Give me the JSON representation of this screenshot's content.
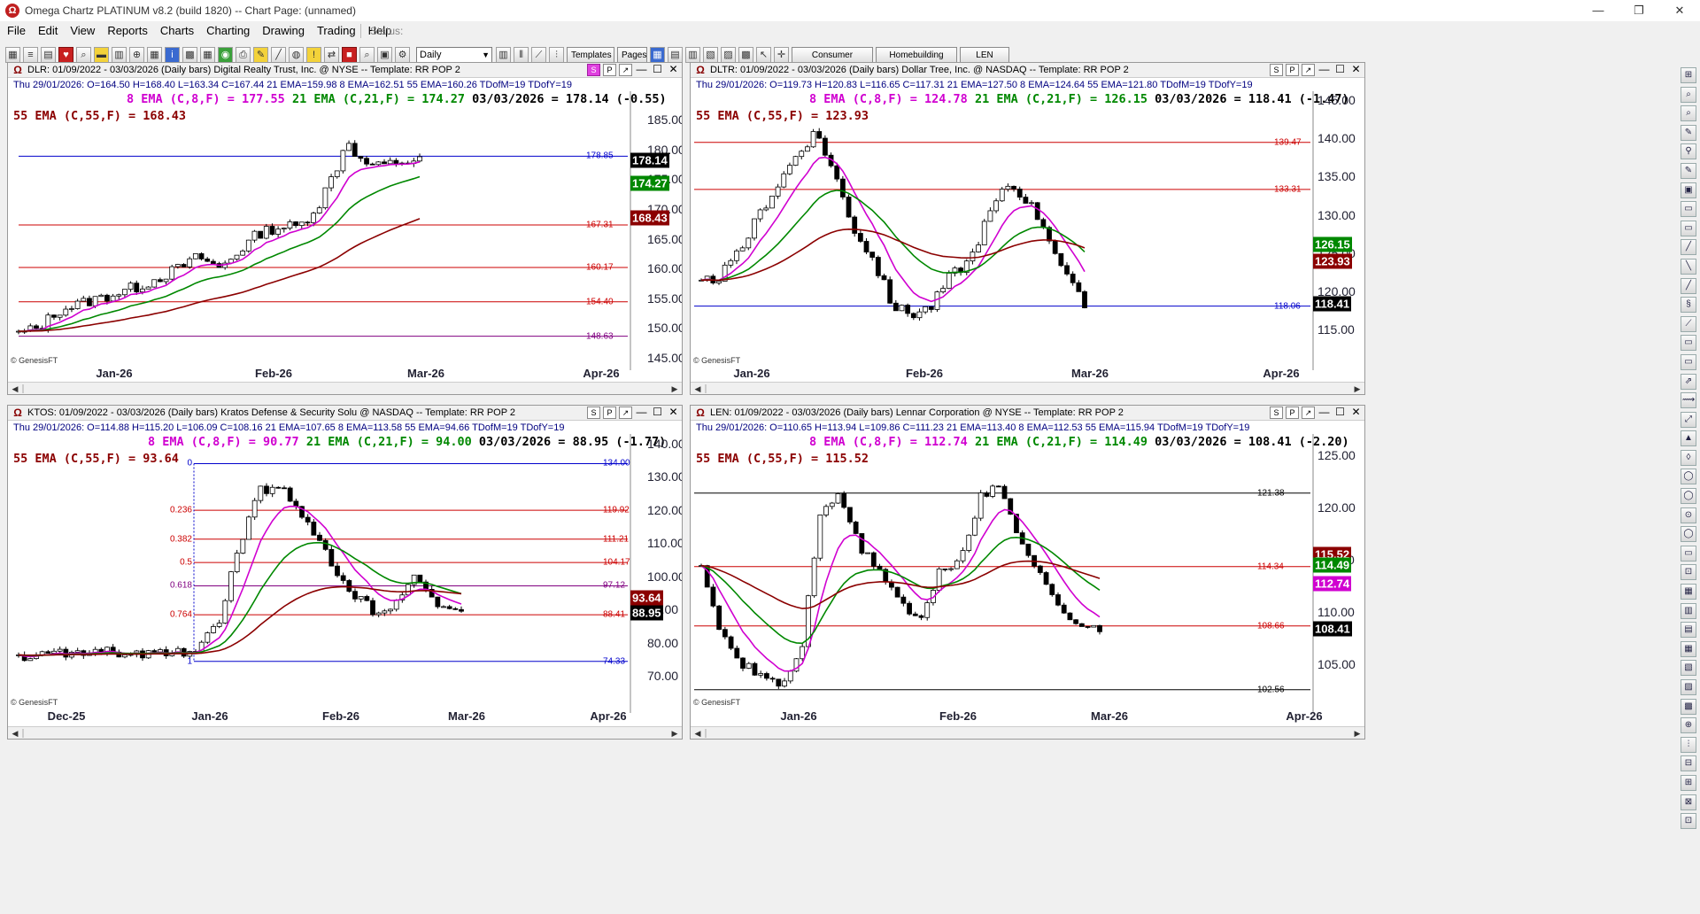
{
  "window": {
    "title": "Omega Chartz PLATINUM v8.2 (build 1820)  --  Chart Page: (unnamed)",
    "icon": "omega-app-icon"
  },
  "menu": {
    "items": [
      "File",
      "Edit",
      "View",
      "Reports",
      "Charts",
      "Charting",
      "Drawing",
      "Trading",
      "Help"
    ],
    "status_label": "Status:"
  },
  "toolbar": {
    "period_select": "Daily",
    "templates_label": "Templates",
    "pages_label": "Pages",
    "tabs": [
      "Consumer Durables & A",
      "Homebuilding",
      "LEN"
    ]
  },
  "charts": [
    {
      "id": "dlr",
      "header": "DLR: 01/09/2022 - 03/03/2026  (Daily bars)   Digital Realty Trust, Inc. @ NYSE  --  Template: RR POP 2",
      "quote": "Thu  29/01/2026:  O=164.50  H=168.40  L=163.34  C=167.44  21 EMA=159.98  8 EMA=162.51  55 EMA=160.26  TDofM=19  TDofY=19",
      "ema8": "8 EMA (C,8,F) = 177.55",
      "ema21": "21 EMA (C,21,F) = 174.27",
      "last": "03/03/2026 = 178.14 (-0.55)",
      "ema55": "55 EMA (C,55,F) = 168.43",
      "yticks": [
        "185.00",
        "180.00",
        "175.00",
        "170.00",
        "165.00",
        "160.00",
        "155.00",
        "150.00",
        "145.00"
      ],
      "levels": [
        "178.85",
        "167.31",
        "160.17",
        "154.40",
        "148.63"
      ],
      "price_boxes": [
        "178.14",
        "174.27",
        "168.43"
      ],
      "xlabels": [
        "Jan-26",
        "Feb-26",
        "Mar-26",
        "Apr-26"
      ],
      "credit": "© GenesisFT"
    },
    {
      "id": "dltr",
      "header": "DLTR: 01/09/2022 - 03/03/2026  (Daily bars)   Dollar Tree, Inc. @ NASDAQ  --  Template: RR POP 2",
      "quote": "Thu  29/01/2026:  O=119.73  H=120.83  L=116.65  C=117.31  21 EMA=127.50  8 EMA=124.64  55 EMA=121.80  TDofM=19  TDofY=19",
      "ema8": "8 EMA (C,8,F) = 124.78",
      "ema21": "21 EMA (C,21,F) = 126.15",
      "last": "03/03/2026 = 118.41 (-1.47)",
      "ema55": "55 EMA (C,55,F) = 123.93",
      "yticks": [
        "145.00",
        "140.00",
        "135.00",
        "130.00",
        "125.00",
        "120.00",
        "115.00"
      ],
      "levels": [
        "139.47",
        "133.31",
        "118.06"
      ],
      "price_boxes": [
        "126.15",
        "123.93",
        "118.41"
      ],
      "xlabels": [
        "Jan-26",
        "Feb-26",
        "Mar-26",
        "Apr-26"
      ],
      "credit": "© GenesisFT"
    },
    {
      "id": "ktos",
      "header": "KTOS: 01/09/2022 - 03/03/2026  (Daily bars)   Kratos Defense & Security Solu @ NASDAQ  --  Template: RR POP 2",
      "quote": "Thu  29/01/2026:  O=114.88  H=115.20  L=106.09  C=108.16  21 EMA=107.65  8 EMA=113.58  55 EMA=94.66  TDofM=19  TDofY=19",
      "ema8": "8 EMA (C,8,F) = 90.77",
      "ema21": "21 EMA (C,21,F) = 94.00",
      "last": "03/03/2026 = 88.95 (-1.77)",
      "ema55": "55 EMA (C,55,F) = 93.64",
      "yticks": [
        "140.00",
        "130.00",
        "120.00",
        "110.00",
        "100.00",
        "90.00",
        "80.00",
        "70.00"
      ],
      "levels": [
        "134.00",
        "119.92",
        "111.21",
        "104.17",
        "97.12",
        "88.41",
        "74.33"
      ],
      "fib_labels": [
        "0",
        "0.236",
        "0.382",
        "0.5",
        "0.618",
        "0.764",
        "1"
      ],
      "price_boxes": [
        "93.64",
        "88.95"
      ],
      "xlabels": [
        "Dec-25",
        "Jan-26",
        "Feb-26",
        "Mar-26",
        "Apr-26"
      ],
      "credit": "© GenesisFT"
    },
    {
      "id": "len",
      "header": "LEN: 01/09/2022 - 03/03/2026  (Daily bars)   Lennar Corporation @ NYSE  --  Template: RR POP 2",
      "quote": "Thu  29/01/2026:  O=110.65  H=113.94  L=109.86  C=111.23  21 EMA=113.40  8 EMA=112.53  55 EMA=115.94  TDofM=19  TDofY=19",
      "ema8": "8 EMA (C,8,F) = 112.74",
      "ema21": "21 EMA (C,21,F) = 114.49",
      "last": "03/03/2026 = 108.41 (-2.20)",
      "ema55": "55 EMA (C,55,F) = 115.52",
      "yticks": [
        "125.00",
        "120.00",
        "115.00",
        "110.00",
        "105.00"
      ],
      "levels": [
        "121.38",
        "114.34",
        "108.66",
        "102.56"
      ],
      "price_boxes": [
        "115.52",
        "114.49",
        "112.74",
        "108.41"
      ],
      "xlabels": [
        "Jan-26",
        "Feb-26",
        "Mar-26",
        "Apr-26"
      ],
      "credit": "© GenesisFT"
    }
  ],
  "colors": {
    "ema8": "#d000d0",
    "ema21": "#008800",
    "ema55": "#8b0000",
    "level_red": "#cc0000",
    "level_blue": "#0000cc",
    "level_purple": "#800080"
  }
}
